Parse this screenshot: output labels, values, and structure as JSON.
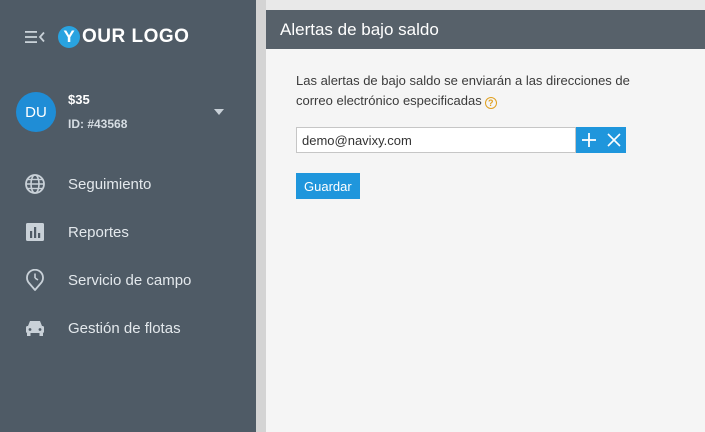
{
  "sidebar": {
    "logo": {
      "letter": "Y",
      "text": "OUR LOGO"
    },
    "user": {
      "initials": "DU",
      "balance": "$35",
      "account_id": "ID: #43568"
    },
    "nav": [
      {
        "label": "Seguimiento",
        "icon": "globe-icon"
      },
      {
        "label": "Reportes",
        "icon": "bar-chart-icon"
      },
      {
        "label": "Servicio de campo",
        "icon": "clock-pin-icon"
      },
      {
        "label": "Gestión de flotas",
        "icon": "car-icon"
      }
    ]
  },
  "panel": {
    "title": "Alertas de bajo saldo",
    "description": "Las alertas de bajo saldo se enviarán a las direcciones de correo electrónico especificadas",
    "help_glyph": "?",
    "email_value": "demo@navixy.com",
    "save_label": "Guardar"
  },
  "colors": {
    "sidebar": "#4f5b66",
    "header": "#57616a",
    "accent": "#1f96dc",
    "help": "#e0a020"
  }
}
